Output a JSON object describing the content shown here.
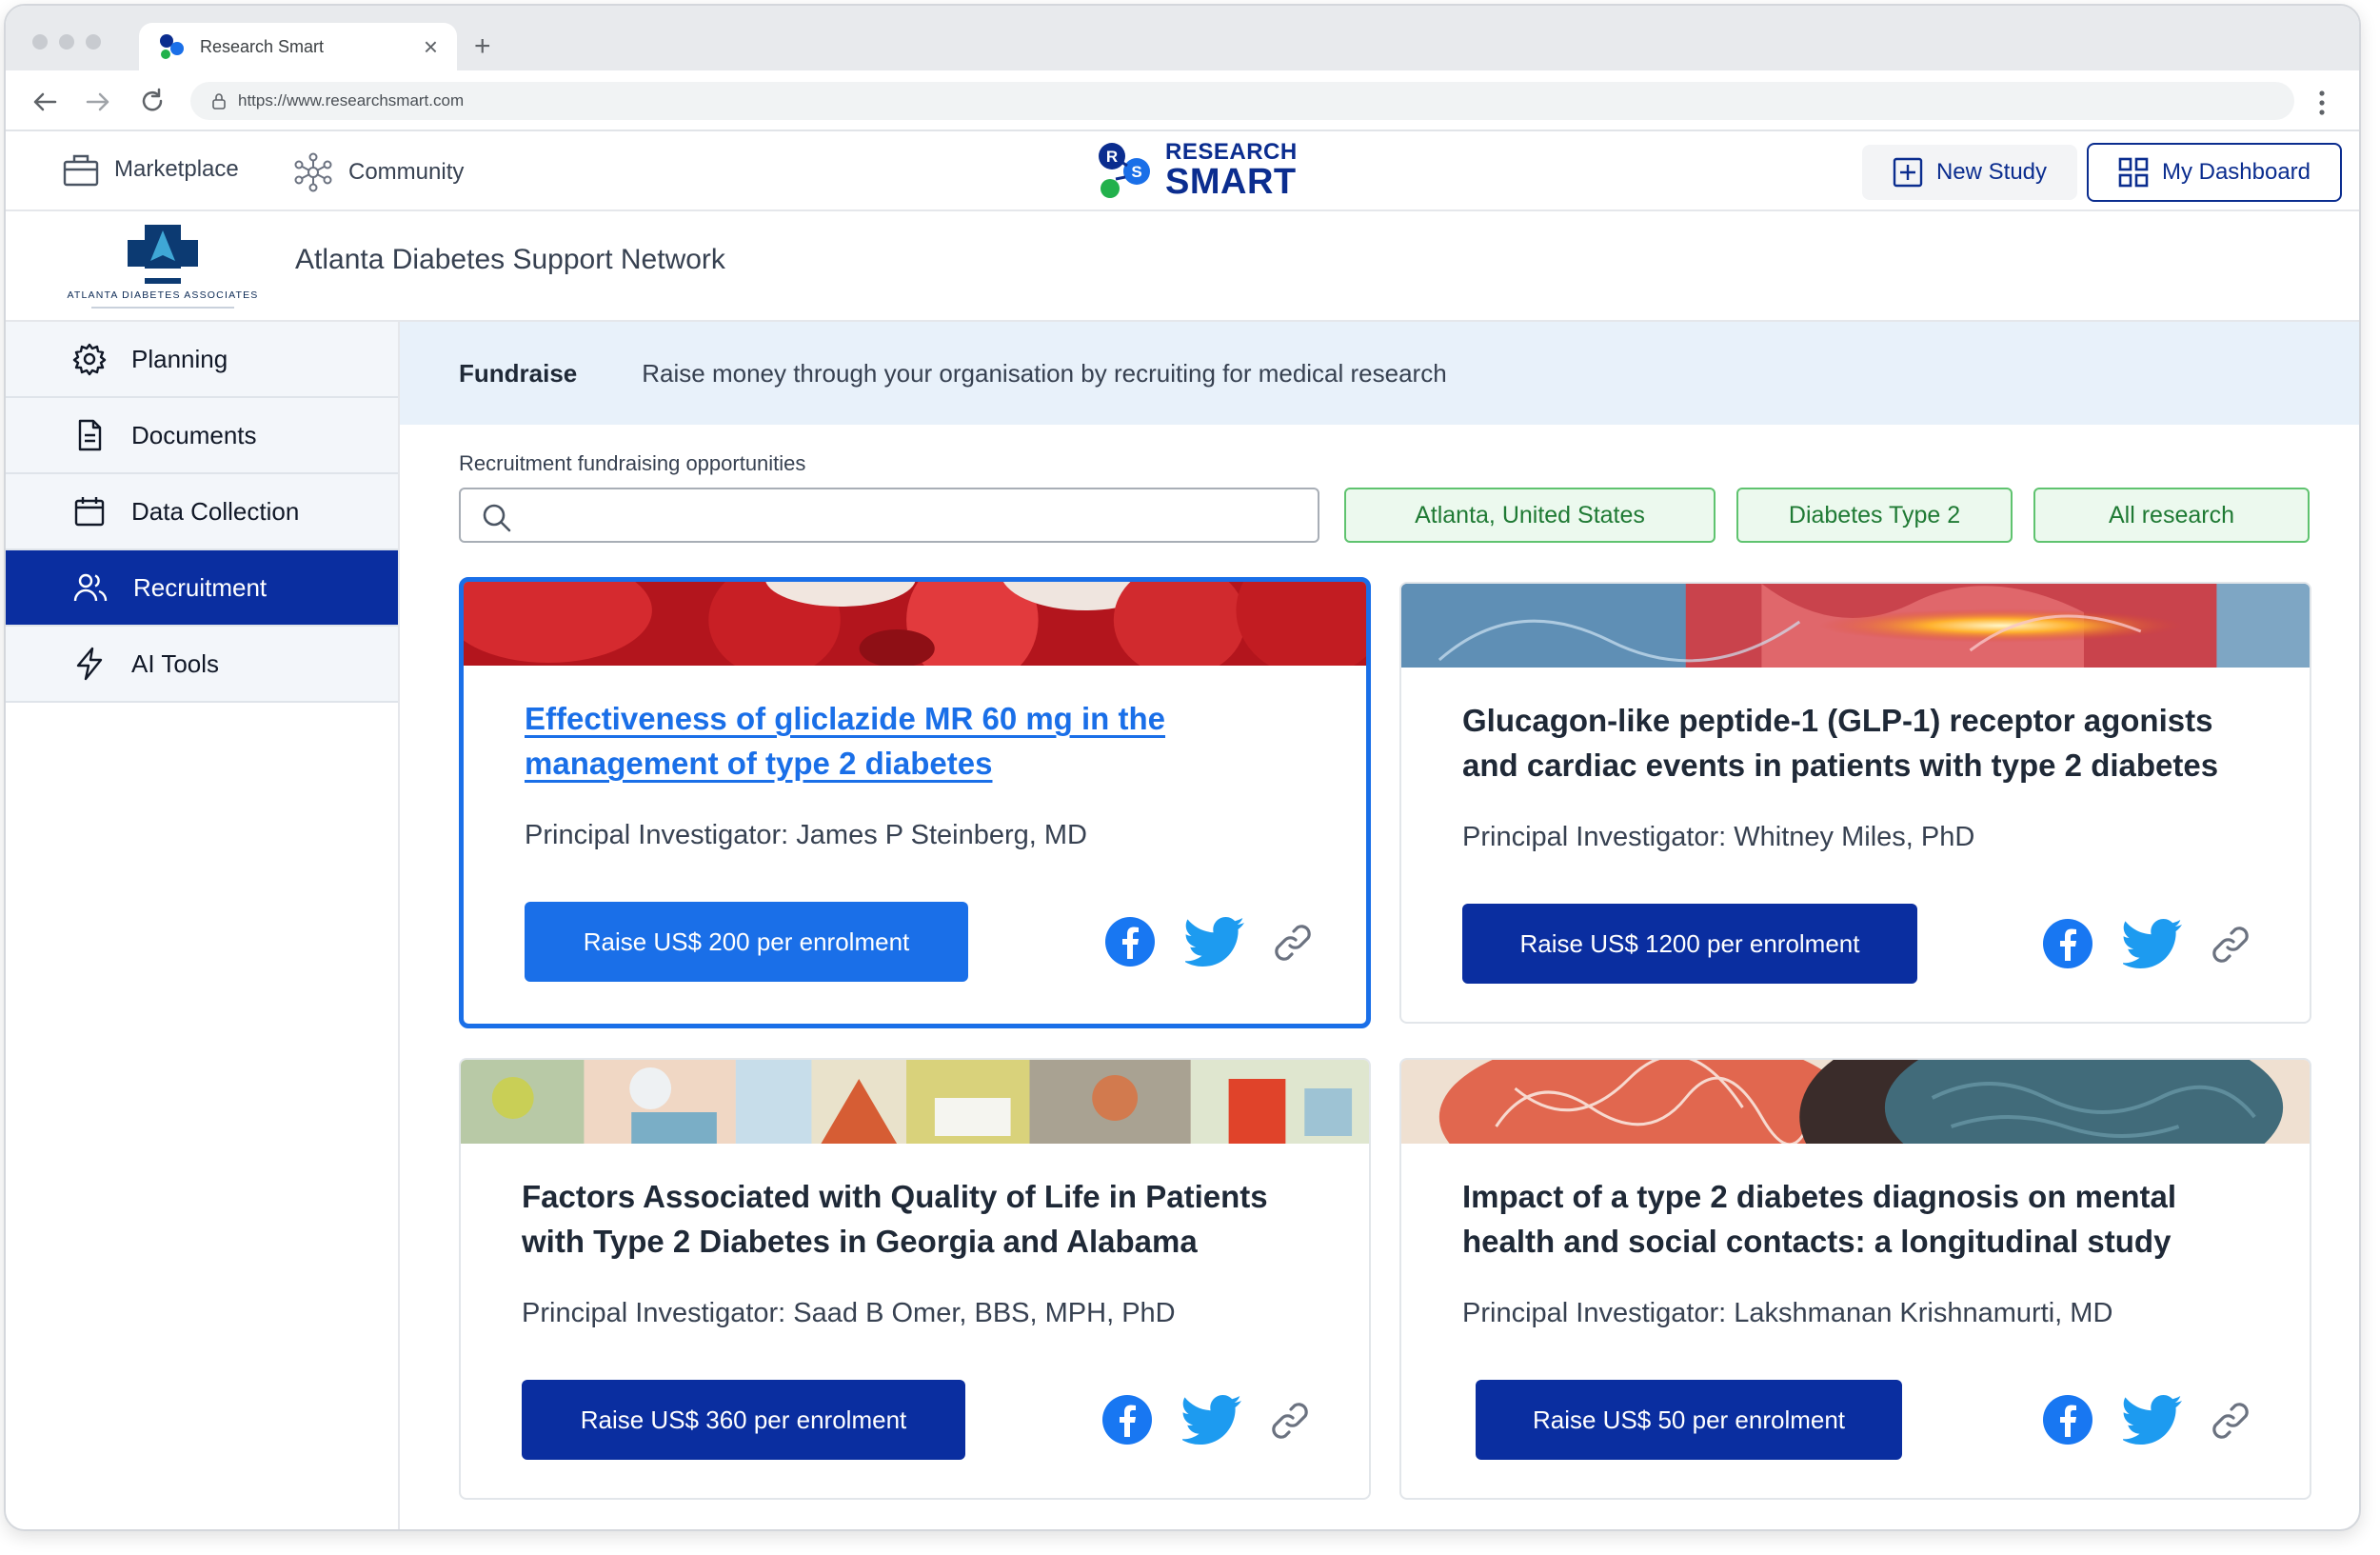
{
  "browser": {
    "tab_title": "Research Smart",
    "url": "https://www.researchsmart.com",
    "new_tab": "+",
    "close": "×"
  },
  "header": {
    "marketplace": "Marketplace",
    "community": "Community",
    "logo_line1": "RESEARCH",
    "logo_line2": "SMART",
    "new_study": "New Study",
    "dashboard": "My Dashboard"
  },
  "org": {
    "name": "Atlanta Diabetes Support Network",
    "logo_text": "ATLANTA DIABETES ASSOCIATES"
  },
  "sidebar": {
    "items": [
      {
        "label": "Planning",
        "icon": "gear-icon",
        "active": false
      },
      {
        "label": "Documents",
        "icon": "document-icon",
        "active": false
      },
      {
        "label": "Data Collection",
        "icon": "calendar-icon",
        "active": false
      },
      {
        "label": "Recruitment",
        "icon": "users-icon",
        "active": true
      },
      {
        "label": "AI Tools",
        "icon": "lightning-icon",
        "active": false
      }
    ]
  },
  "fundraise": {
    "title": "Fundraise",
    "description": "Raise money through your organisation by recruiting for medical research"
  },
  "search": {
    "label": "Recruitment fundraising opportunities",
    "value": "",
    "placeholder": ""
  },
  "filters": [
    "Atlanta, United States",
    "Diabetes Type 2",
    "All research"
  ],
  "cards": [
    {
      "title": "Effectiveness of gliclazide MR 60 mg in the management of type 2 diabetes",
      "pi": "Principal Investigator: James P Steinberg, MD",
      "button": "Raise US$ 200 per enrolment",
      "selected": true
    },
    {
      "title": "Glucagon-like peptide-1 (GLP-1) receptor agonists and cardiac events in patients with type 2 diabetes",
      "pi": "Principal Investigator: Whitney Miles, PhD",
      "button": "Raise US$ 1200 per enrolment",
      "selected": false
    },
    {
      "title": "Factors Associated with Quality of Life in Patients with Type 2 Diabetes in Georgia and Alabama",
      "pi": "Principal Investigator: Saad B Omer, BBS, MPH, PhD",
      "button": "Raise US$ 360 per enrolment",
      "selected": false
    },
    {
      "title": "Impact of a type 2 diabetes diagnosis on mental health and social contacts: a longitudinal study",
      "pi": "Principal Investigator: Lakshmanan Krishnamurti, MD",
      "button": "Raise US$ 50 per enrolment",
      "selected": false
    }
  ],
  "colors": {
    "brand_navy": "#0a2ea0",
    "link_blue": "#1a6fe8",
    "chip_green": "#5fc36f",
    "facebook": "#1877f2",
    "twitter": "#1d9bf0"
  }
}
